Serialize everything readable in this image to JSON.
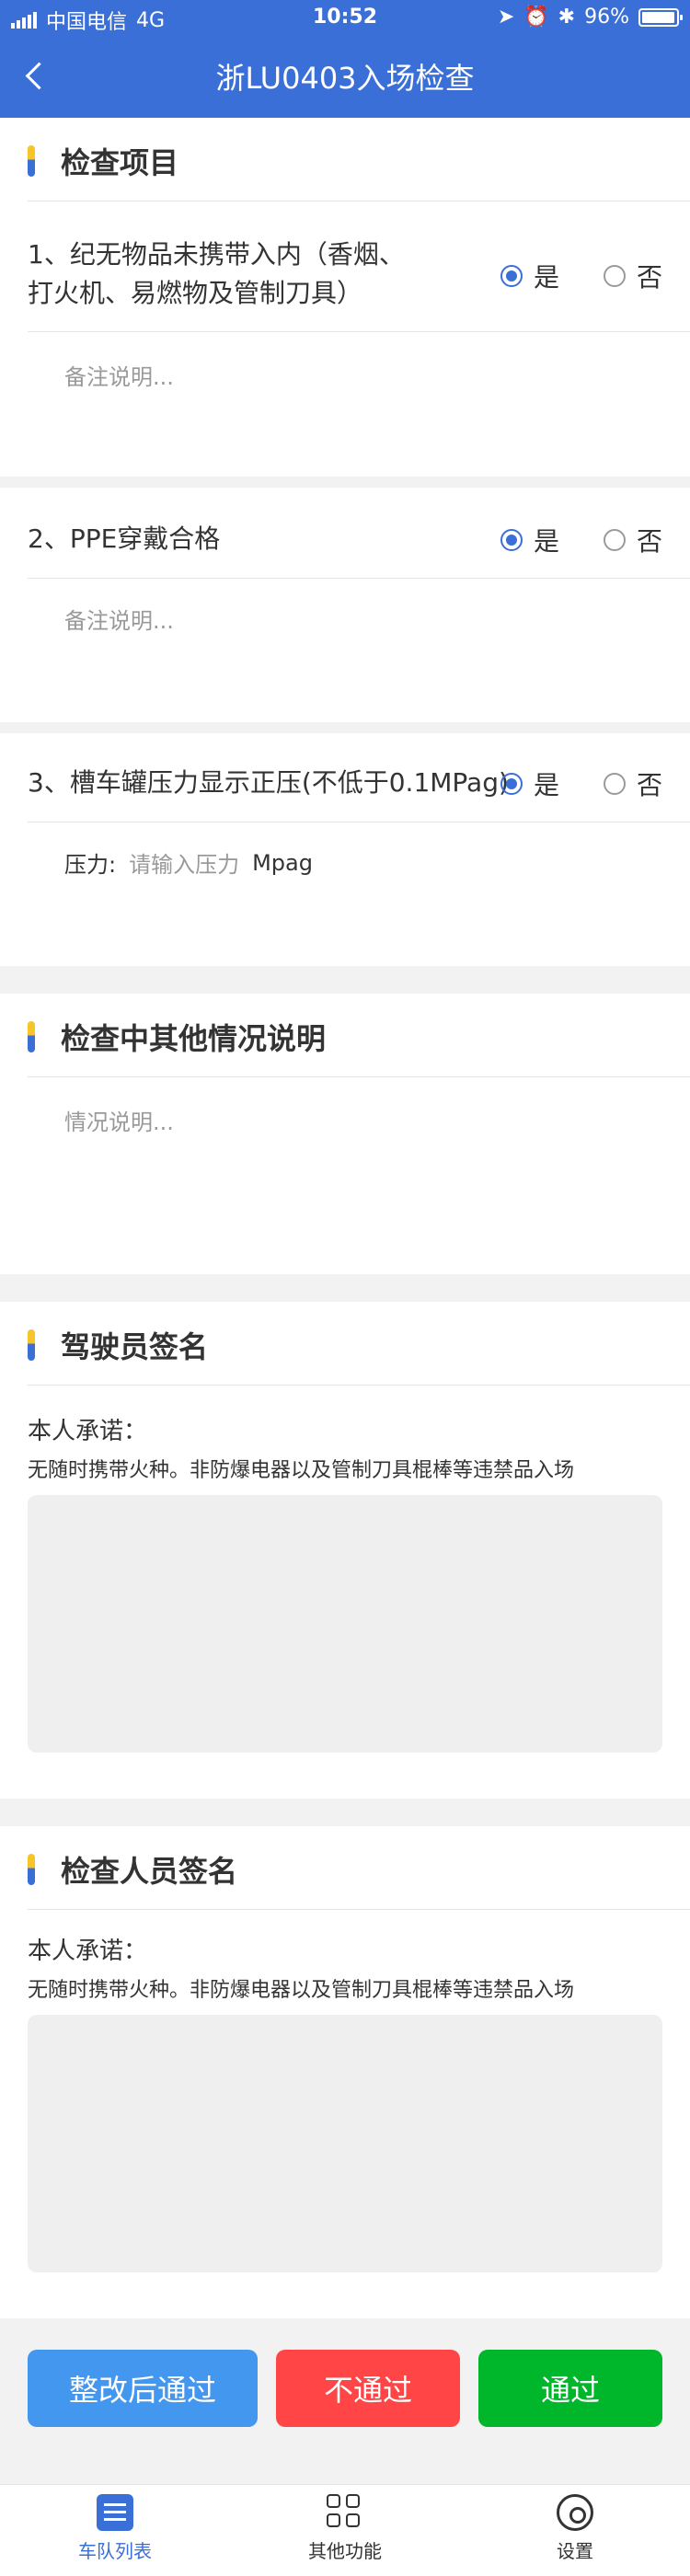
{
  "status_bar": {
    "carrier": "中国电信",
    "network": "4G",
    "time": "10:52",
    "battery": "96%",
    "battery_level": 0.96
  },
  "header": {
    "title": "浙LU0403入场检查"
  },
  "sections": {
    "inspection": {
      "title": "检查项目"
    },
    "other": {
      "title": "检查中其他情况说明",
      "placeholder": "情况说明..."
    },
    "driver": {
      "title": "驾驶员签名",
      "promise": "本人承诺：",
      "promise_text": "无随时携带火种。非防爆电器以及管制刀具棍棒等违禁品入场"
    },
    "inspector": {
      "title": "检查人员签名",
      "promise": "本人承诺：",
      "promise_text": "无随时携带火种。非防爆电器以及管制刀具棍棒等违禁品入场"
    }
  },
  "items": [
    {
      "text_line1": "1、纪无物品未携带入内（香烟、",
      "text_line2": "打火机、易燃物及管制刀具）",
      "yes": "是",
      "no": "否",
      "note_placeholder": "备注说明..."
    },
    {
      "text": "2、PPE穿戴合格",
      "yes": "是",
      "no": "否",
      "note_placeholder": "备注说明..."
    },
    {
      "text": "3、槽车罐压力显示正压(不低于0.1MPag)",
      "yes": "是",
      "no": "否",
      "pressure_label": "压力:",
      "pressure_placeholder": "请输入压力",
      "pressure_unit": "Mpag"
    }
  ],
  "actions": {
    "rectify_pass": "整改后通过",
    "reject": "不通过",
    "pass": "通过"
  },
  "colors": {
    "blue_button": "#4397EF",
    "red_button": "#FF4545",
    "green_button": "#00B62B",
    "text": "#333333",
    "line": "#93C9FF"
  },
  "tabbar": {
    "tabs": [
      {
        "label": "车队列表",
        "icon": "list-icon"
      },
      {
        "label": "其他功能",
        "icon": "grid-icon"
      },
      {
        "label": "设置",
        "icon": "gear-icon"
      }
    ]
  }
}
